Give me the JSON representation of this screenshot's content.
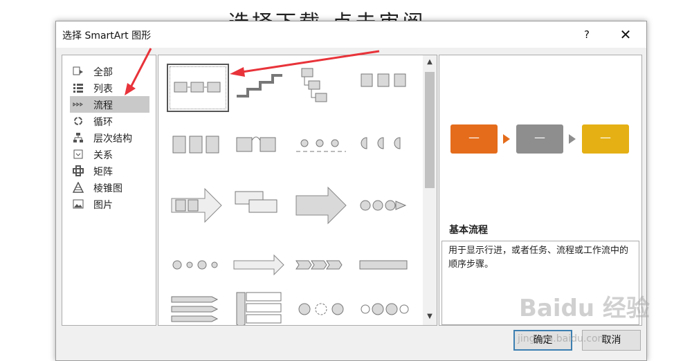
{
  "background": {
    "heading": "选择下载 点击审阅"
  },
  "dialog": {
    "title": "选择 SmartArt 图形",
    "help": "?",
    "close": "✕"
  },
  "categories": [
    {
      "label": "全部",
      "icon": "all-icon"
    },
    {
      "label": "列表",
      "icon": "list-icon"
    },
    {
      "label": "流程",
      "icon": "process-icon",
      "selected": true
    },
    {
      "label": "循环",
      "icon": "cycle-icon"
    },
    {
      "label": "层次结构",
      "icon": "hierarchy-icon"
    },
    {
      "label": "关系",
      "icon": "relationship-icon"
    },
    {
      "label": "矩阵",
      "icon": "matrix-icon"
    },
    {
      "label": "棱锥图",
      "icon": "pyramid-icon"
    },
    {
      "label": "图片",
      "icon": "picture-icon"
    }
  ],
  "gallery": {
    "selected_index": 0,
    "scroll_up": "▲",
    "scroll_down": "▼"
  },
  "preview": {
    "name": "基本流程",
    "description": "用于显示行进，或者任务、流程或工作流中的顺序步骤。",
    "box_label": "—",
    "colors": {
      "box1": "#e46c1b",
      "box2": "#8e8e8e",
      "box3": "#e4b014"
    }
  },
  "buttons": {
    "ok": "确定",
    "cancel": "取消"
  },
  "watermark": {
    "logo": "Baidu 经验",
    "url": "jingyan.baidu.com"
  },
  "annotations": {
    "arrow_color": "#e8333a"
  }
}
